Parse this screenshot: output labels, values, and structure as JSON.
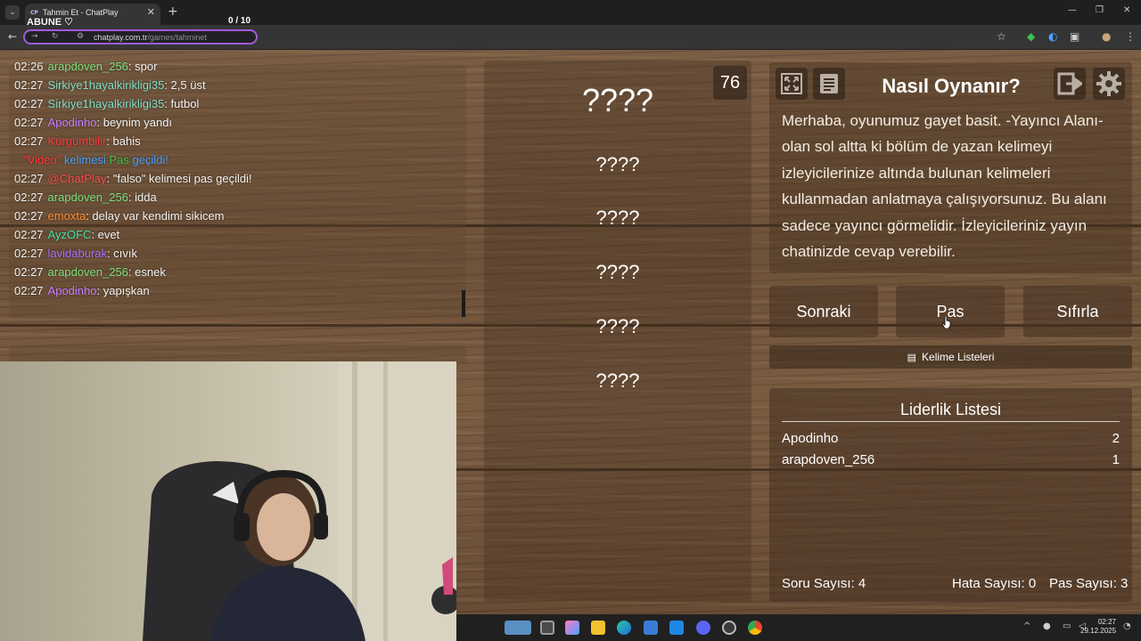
{
  "browser": {
    "tab_title": "Tahmin Et - ChatPlay",
    "tab_favicon": "CP",
    "url_host": "chatplay.com.tr",
    "url_path": "/games/tahminet",
    "overlay_subscribe": "ABUNE ♡",
    "overlay_counter": "0  / 10"
  },
  "chat": {
    "messages": [
      {
        "time": "02:26",
        "user": "arapdoven_256",
        "color": "#7ee07e",
        "text": ": spor"
      },
      {
        "time": "02:27",
        "user": "Sirkiye1hayalkirikligi35",
        "color": "#7fe0c8",
        "text": ": 2,5 üst"
      },
      {
        "time": "02:27",
        "user": "Sirkiye1hayalkirikligi35",
        "color": "#7fe0c8",
        "text": ": futbol"
      },
      {
        "time": "02:27",
        "user": "Apodinho",
        "color": "#c77cff",
        "text": ": beynim yandı"
      },
      {
        "time": "02:27",
        "user": "Kurgumbilir",
        "color": "#ff3b3b",
        "text": ": bahis"
      },
      {
        "time": "02:27",
        "user": "ChatPlay",
        "color": "#ff4b4b",
        "text": ": \"falso\" kelimesi pas geçildi!"
      },
      {
        "time": "02:27",
        "user": "arapdoven_256",
        "color": "#7ee07e",
        "text": ": idda"
      },
      {
        "time": "02:27",
        "user": "emoxta",
        "color": "#ff8c2b",
        "text": ": delay var kendimi sikicem"
      },
      {
        "time": "02:27",
        "user": "AyzOFC",
        "color": "#45e0a8",
        "text": ": evet"
      },
      {
        "time": "02:27",
        "user": "lavidaburak",
        "color": "#b070ff",
        "text": ": cıvık"
      },
      {
        "time": "02:27",
        "user": "arapdoven_256",
        "color": "#7ee07e",
        "text": ": esnek"
      },
      {
        "time": "02:27",
        "user": "Apodinho",
        "color": "#c77cff",
        "text": ": yapışkan"
      }
    ],
    "system_notice": {
      "word": "\"Video\"",
      "word_color": "#ff3b3b",
      "middle": " kelimesi ",
      "middle_color": "#4aa3ff",
      "status": "Pas",
      "status_color": "#3ec24a",
      "end": " geçildi!",
      "end_color": "#4aa3ff"
    },
    "mention": "@ChatPlay"
  },
  "game": {
    "timer": "76",
    "words": [
      "????",
      "????",
      "????",
      "????",
      "????",
      "????"
    ]
  },
  "howto": {
    "title": "Nasıl Oynanır?",
    "body": "Merhaba, oyunumuz gayet basit. -Yayıncı Alanı- olan sol altta ki bölüm de yazan kelimeyi izleyicilerinize altında bulunan kelimeleri kullanmadan anlatmaya çalışıyorsunuz. Bu alanı sadece yayıncı görmelidir. İzleyicileriniz yayın chatinizde cevap verebilir."
  },
  "actions": {
    "next": "Sonraki",
    "pass": "Pas",
    "reset": "Sıfırla",
    "word_lists": "Kelime Listeleri"
  },
  "leaderboard": {
    "title": "Liderlik Listesi",
    "rows": [
      {
        "name": "Apodinho",
        "score": "2"
      },
      {
        "name": "arapdoven_256",
        "score": "1"
      }
    ]
  },
  "stats": {
    "questions": "Soru Sayısı: 4",
    "errors": "Hata Sayısı: 0",
    "passes": "Pas Sayısı: 3"
  },
  "tray": {
    "time": "02:27",
    "date": "29.12.2025"
  }
}
